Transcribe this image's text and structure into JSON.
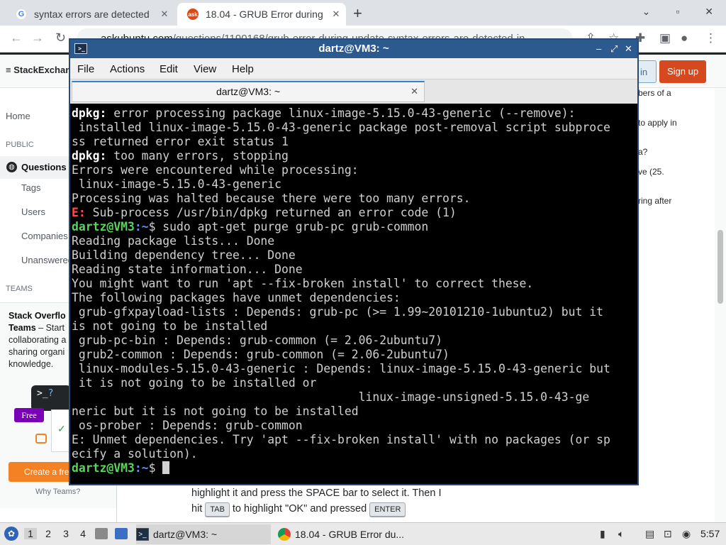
{
  "browser": {
    "tabs": [
      {
        "title": "syntax errors are detected",
        "favicon": "google-icon"
      },
      {
        "title": "18.04 - GRUB Error during",
        "favicon": "askubuntu-icon",
        "active": true
      }
    ],
    "url_host": "askubuntu.com",
    "url_path": "/questions/1190168/grub-error-during-update-syntax-errors-are-detected-in"
  },
  "so": {
    "logo": "StackExchange",
    "login": "in",
    "signup": "Sign up",
    "nav": {
      "home": "Home",
      "public": "PUBLIC",
      "questions": "Questions",
      "tags": "Tags",
      "users": "Users",
      "companies": "Companies",
      "unanswered": "Unanswered",
      "teams": "TEAMS"
    },
    "teams_box": {
      "line1": "Stack Overflo",
      "line2_bold": "Teams",
      "line2_rest": " – Start",
      "line3": "collaborating a",
      "line4": "sharing organi",
      "line5": "knowledge.",
      "icon_text": ">_",
      "icon_q": "?",
      "free": "Free",
      "create": "Create a free",
      "why": "Why Teams?"
    },
    "right_snippets": [
      "bers of a",
      "to apply in",
      "a?",
      "ve (25.",
      "ring after"
    ],
    "body_line1": "highlight it and press the SPACE bar to select it. Then I",
    "body_hit": "hit",
    "kbd_tab": "TAB",
    "body_mid": "to highlight \"OK\" and pressed",
    "kbd_enter": "ENTER"
  },
  "terminal": {
    "title": "dartz@VM3: ~",
    "menu": [
      "File",
      "Actions",
      "Edit",
      "View",
      "Help"
    ],
    "tab_title": "dartz@VM3: ~",
    "prompt_user": "dartz@VM3",
    "prompt_path": ":~",
    "lines": {
      "l1_label": "dpkg:",
      "l1_text": " error processing package linux-image-5.15.0-43-generic (--remove):",
      "l2": " installed linux-image-5.15.0-43-generic package post-removal script subproce",
      "l3": "ss returned error exit status 1",
      "l4_label": "dpkg:",
      "l4_text": " too many errors, stopping",
      "l5": "Errors were encountered while processing:",
      "l6": " linux-image-5.15.0-43-generic",
      "l7": "Processing was halted because there were too many errors.",
      "l8_label": "E:",
      "l8_text": " Sub-process /usr/bin/dpkg returned an error code (1)",
      "l9_cmd": "$ sudo apt-get purge grub-pc grub-common",
      "l10": "Reading package lists... Done",
      "l11": "Building dependency tree... Done",
      "l12": "Reading state information... Done",
      "l13": "You might want to run 'apt --fix-broken install' to correct these.",
      "l14": "The following packages have unmet dependencies:",
      "l15": " grub-gfxpayload-lists : Depends: grub-pc (>= 1.99~20101210-1ubuntu2) but it",
      "l16": "is not going to be installed",
      "l17": " grub-pc-bin : Depends: grub-common (= 2.06-2ubuntu7)",
      "l18": " grub2-common : Depends: grub-common (= 2.06-2ubuntu7)",
      "l19": " linux-modules-5.15.0-43-generic : Depends: linux-image-5.15.0-43-generic but",
      "l20": " it is not going to be installed or",
      "l21": "                                         linux-image-unsigned-5.15.0-43-ge",
      "l22": "neric but it is not going to be installed",
      "l23": " os-prober : Depends: grub-common",
      "l24": "E: Unmet dependencies. Try 'apt --fix-broken install' with no packages (or sp",
      "l25": "ecify a solution).",
      "l26_cmd": "$ "
    }
  },
  "taskbar": {
    "workspaces": [
      "1",
      "2",
      "3",
      "4"
    ],
    "task_terminal": "dartz@VM3: ~",
    "task_chrome": "18.04 - GRUB Error du...",
    "clock": "5:57"
  },
  "colors": {
    "terminal_title_bg": "#2d5a8e",
    "prompt_green": "#5ad45a",
    "error_red": "#ff4b4b",
    "so_orange": "#f48225",
    "signup_red": "#d6491e"
  }
}
